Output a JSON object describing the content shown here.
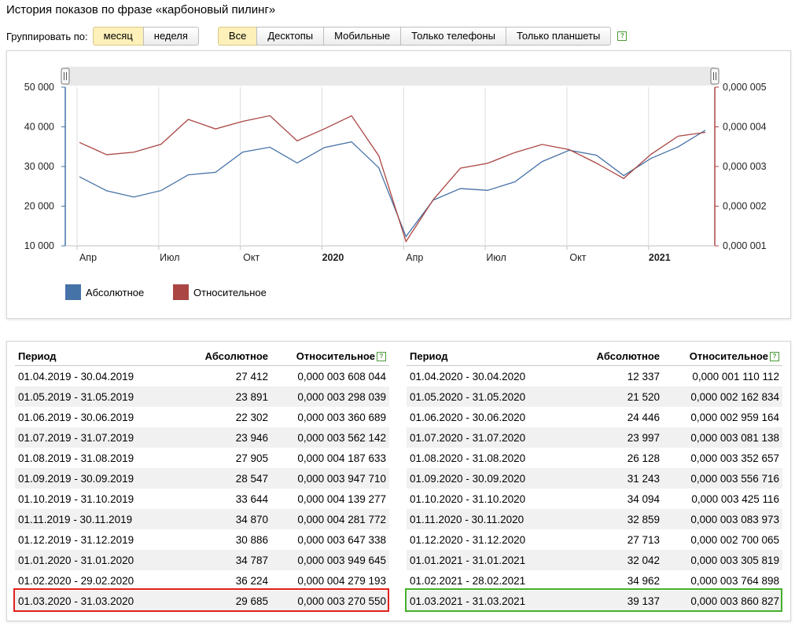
{
  "title": "История показов по фразе «карбоновый пилинг»",
  "group_by": {
    "label": "Группировать по:",
    "options": [
      "месяц",
      "неделя"
    ],
    "active": 0
  },
  "device_filter": {
    "options": [
      "Все",
      "Десктопы",
      "Мобильные",
      "Только телефоны",
      "Только планшеты"
    ],
    "active": 0
  },
  "colors": {
    "absolute": "#4572a7",
    "relative": "#aa4643",
    "active_button": "#fdf0b9",
    "highlight_red": "#e0201b",
    "highlight_green": "#43b02a"
  },
  "chart_data": {
    "type": "line",
    "x": [
      "2019-04",
      "2019-05",
      "2019-06",
      "2019-07",
      "2019-08",
      "2019-09",
      "2019-10",
      "2019-11",
      "2019-12",
      "2020-01",
      "2020-02",
      "2020-03",
      "2020-04",
      "2020-05",
      "2020-06",
      "2020-07",
      "2020-08",
      "2020-09",
      "2020-10",
      "2020-11",
      "2020-12",
      "2021-01",
      "2021-02",
      "2021-03"
    ],
    "x_tick_labels": [
      "Апр",
      "Июл",
      "Окт",
      "2020",
      "Апр",
      "Июл",
      "Окт",
      "2021"
    ],
    "series": [
      {
        "name": "Абсолютное",
        "axis": "left",
        "values": [
          27412,
          23891,
          22302,
          23946,
          27905,
          28547,
          33644,
          34870,
          30886,
          34787,
          36224,
          29685,
          12337,
          21520,
          24446,
          23997,
          26128,
          31243,
          34094,
          32859,
          27713,
          32042,
          34962,
          39137
        ]
      },
      {
        "name": "Относительное",
        "axis": "right",
        "values": [
          3.608044e-06,
          3.298039e-06,
          3.360689e-06,
          3.562142e-06,
          4.187633e-06,
          3.94771e-06,
          4.139277e-06,
          4.281772e-06,
          3.647338e-06,
          3.949645e-06,
          4.279193e-06,
          3.27055e-06,
          1.110112e-06,
          2.162834e-06,
          2.959164e-06,
          3.081138e-06,
          3.352657e-06,
          3.556716e-06,
          3.425116e-06,
          3.083973e-06,
          2.700065e-06,
          3.305819e-06,
          3.764898e-06,
          3.860827e-06
        ]
      }
    ],
    "y_left": {
      "ticks": [
        "50 000",
        "40 000",
        "30 000",
        "20 000",
        "10 000"
      ],
      "range": [
        10000,
        50000
      ]
    },
    "y_right": {
      "ticks": [
        "0,000 005",
        "0,000 004",
        "0,000 003",
        "0,000 002",
        "0,000 001"
      ],
      "range": [
        1e-06,
        5e-06
      ]
    },
    "grid": "vertical",
    "legend_position": "bottom-left"
  },
  "table": {
    "headers": {
      "period": "Период",
      "absolute": "Абсолютное",
      "relative": "Относительное"
    },
    "left": [
      [
        "01.04.2019 - 30.04.2019",
        "27 412",
        "0,000 003 608 044"
      ],
      [
        "01.05.2019 - 31.05.2019",
        "23 891",
        "0,000 003 298 039"
      ],
      [
        "01.06.2019 - 30.06.2019",
        "22 302",
        "0,000 003 360 689"
      ],
      [
        "01.07.2019 - 31.07.2019",
        "23 946",
        "0,000 003 562 142"
      ],
      [
        "01.08.2019 - 31.08.2019",
        "27 905",
        "0,000 004 187 633"
      ],
      [
        "01.09.2019 - 30.09.2019",
        "28 547",
        "0,000 003 947 710"
      ],
      [
        "01.10.2019 - 31.10.2019",
        "33 644",
        "0,000 004 139 277"
      ],
      [
        "01.11.2019 - 30.11.2019",
        "34 870",
        "0,000 004 281 772"
      ],
      [
        "01.12.2019 - 31.12.2019",
        "30 886",
        "0,000 003 647 338"
      ],
      [
        "01.01.2020 - 31.01.2020",
        "34 787",
        "0,000 003 949 645"
      ],
      [
        "01.02.2020 - 29.02.2020",
        "36 224",
        "0,000 004 279 193"
      ],
      [
        "01.03.2020 - 31.03.2020",
        "29 685",
        "0,000 003 270 550"
      ]
    ],
    "right": [
      [
        "01.04.2020 - 30.04.2020",
        "12 337",
        "0,000 001 110 112"
      ],
      [
        "01.05.2020 - 31.05.2020",
        "21 520",
        "0,000 002 162 834"
      ],
      [
        "01.06.2020 - 30.06.2020",
        "24 446",
        "0,000 002 959 164"
      ],
      [
        "01.07.2020 - 31.07.2020",
        "23 997",
        "0,000 003 081 138"
      ],
      [
        "01.08.2020 - 31.08.2020",
        "26 128",
        "0,000 003 352 657"
      ],
      [
        "01.09.2020 - 30.09.2020",
        "31 243",
        "0,000 003 556 716"
      ],
      [
        "01.10.2020 - 31.10.2020",
        "34 094",
        "0,000 003 425 116"
      ],
      [
        "01.11.2020 - 30.11.2020",
        "32 859",
        "0,000 003 083 973"
      ],
      [
        "01.12.2020 - 31.12.2020",
        "27 713",
        "0,000 002 700 065"
      ],
      [
        "01.01.2021 - 31.01.2021",
        "32 042",
        "0,000 003 305 819"
      ],
      [
        "01.02.2021 - 28.02.2021",
        "34 962",
        "0,000 003 764 898"
      ],
      [
        "01.03.2021 - 31.03.2021",
        "39 137",
        "0,000 003 860 827"
      ]
    ]
  }
}
